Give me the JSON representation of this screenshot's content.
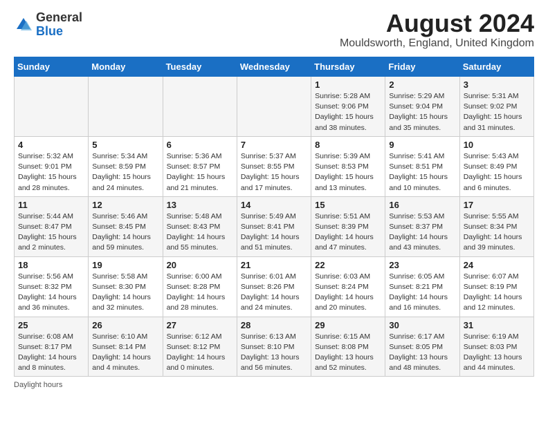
{
  "header": {
    "logo_general": "General",
    "logo_blue": "Blue",
    "month_year": "August 2024",
    "location": "Mouldsworth, England, United Kingdom"
  },
  "days_of_week": [
    "Sunday",
    "Monday",
    "Tuesday",
    "Wednesday",
    "Thursday",
    "Friday",
    "Saturday"
  ],
  "weeks": [
    [
      {
        "day": "",
        "info": ""
      },
      {
        "day": "",
        "info": ""
      },
      {
        "day": "",
        "info": ""
      },
      {
        "day": "",
        "info": ""
      },
      {
        "day": "1",
        "info": "Sunrise: 5:28 AM\nSunset: 9:06 PM\nDaylight: 15 hours\nand 38 minutes."
      },
      {
        "day": "2",
        "info": "Sunrise: 5:29 AM\nSunset: 9:04 PM\nDaylight: 15 hours\nand 35 minutes."
      },
      {
        "day": "3",
        "info": "Sunrise: 5:31 AM\nSunset: 9:02 PM\nDaylight: 15 hours\nand 31 minutes."
      }
    ],
    [
      {
        "day": "4",
        "info": "Sunrise: 5:32 AM\nSunset: 9:01 PM\nDaylight: 15 hours\nand 28 minutes."
      },
      {
        "day": "5",
        "info": "Sunrise: 5:34 AM\nSunset: 8:59 PM\nDaylight: 15 hours\nand 24 minutes."
      },
      {
        "day": "6",
        "info": "Sunrise: 5:36 AM\nSunset: 8:57 PM\nDaylight: 15 hours\nand 21 minutes."
      },
      {
        "day": "7",
        "info": "Sunrise: 5:37 AM\nSunset: 8:55 PM\nDaylight: 15 hours\nand 17 minutes."
      },
      {
        "day": "8",
        "info": "Sunrise: 5:39 AM\nSunset: 8:53 PM\nDaylight: 15 hours\nand 13 minutes."
      },
      {
        "day": "9",
        "info": "Sunrise: 5:41 AM\nSunset: 8:51 PM\nDaylight: 15 hours\nand 10 minutes."
      },
      {
        "day": "10",
        "info": "Sunrise: 5:43 AM\nSunset: 8:49 PM\nDaylight: 15 hours\nand 6 minutes."
      }
    ],
    [
      {
        "day": "11",
        "info": "Sunrise: 5:44 AM\nSunset: 8:47 PM\nDaylight: 15 hours\nand 2 minutes."
      },
      {
        "day": "12",
        "info": "Sunrise: 5:46 AM\nSunset: 8:45 PM\nDaylight: 14 hours\nand 59 minutes."
      },
      {
        "day": "13",
        "info": "Sunrise: 5:48 AM\nSunset: 8:43 PM\nDaylight: 14 hours\nand 55 minutes."
      },
      {
        "day": "14",
        "info": "Sunrise: 5:49 AM\nSunset: 8:41 PM\nDaylight: 14 hours\nand 51 minutes."
      },
      {
        "day": "15",
        "info": "Sunrise: 5:51 AM\nSunset: 8:39 PM\nDaylight: 14 hours\nand 47 minutes."
      },
      {
        "day": "16",
        "info": "Sunrise: 5:53 AM\nSunset: 8:37 PM\nDaylight: 14 hours\nand 43 minutes."
      },
      {
        "day": "17",
        "info": "Sunrise: 5:55 AM\nSunset: 8:34 PM\nDaylight: 14 hours\nand 39 minutes."
      }
    ],
    [
      {
        "day": "18",
        "info": "Sunrise: 5:56 AM\nSunset: 8:32 PM\nDaylight: 14 hours\nand 36 minutes."
      },
      {
        "day": "19",
        "info": "Sunrise: 5:58 AM\nSunset: 8:30 PM\nDaylight: 14 hours\nand 32 minutes."
      },
      {
        "day": "20",
        "info": "Sunrise: 6:00 AM\nSunset: 8:28 PM\nDaylight: 14 hours\nand 28 minutes."
      },
      {
        "day": "21",
        "info": "Sunrise: 6:01 AM\nSunset: 8:26 PM\nDaylight: 14 hours\nand 24 minutes."
      },
      {
        "day": "22",
        "info": "Sunrise: 6:03 AM\nSunset: 8:24 PM\nDaylight: 14 hours\nand 20 minutes."
      },
      {
        "day": "23",
        "info": "Sunrise: 6:05 AM\nSunset: 8:21 PM\nDaylight: 14 hours\nand 16 minutes."
      },
      {
        "day": "24",
        "info": "Sunrise: 6:07 AM\nSunset: 8:19 PM\nDaylight: 14 hours\nand 12 minutes."
      }
    ],
    [
      {
        "day": "25",
        "info": "Sunrise: 6:08 AM\nSunset: 8:17 PM\nDaylight: 14 hours\nand 8 minutes."
      },
      {
        "day": "26",
        "info": "Sunrise: 6:10 AM\nSunset: 8:14 PM\nDaylight: 14 hours\nand 4 minutes."
      },
      {
        "day": "27",
        "info": "Sunrise: 6:12 AM\nSunset: 8:12 PM\nDaylight: 14 hours\nand 0 minutes."
      },
      {
        "day": "28",
        "info": "Sunrise: 6:13 AM\nSunset: 8:10 PM\nDaylight: 13 hours\nand 56 minutes."
      },
      {
        "day": "29",
        "info": "Sunrise: 6:15 AM\nSunset: 8:08 PM\nDaylight: 13 hours\nand 52 minutes."
      },
      {
        "day": "30",
        "info": "Sunrise: 6:17 AM\nSunset: 8:05 PM\nDaylight: 13 hours\nand 48 minutes."
      },
      {
        "day": "31",
        "info": "Sunrise: 6:19 AM\nSunset: 8:03 PM\nDaylight: 13 hours\nand 44 minutes."
      }
    ]
  ],
  "footer": {
    "note": "Daylight hours"
  }
}
